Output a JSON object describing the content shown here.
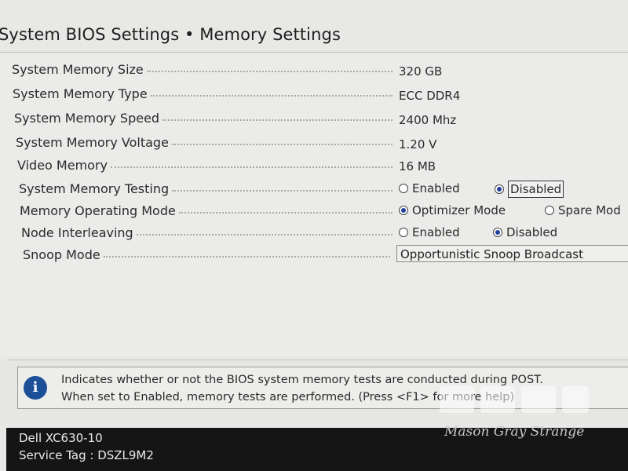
{
  "header": {
    "title": "System BIOS Settings • Memory Settings"
  },
  "settings": {
    "memory_size": {
      "label": "System Memory Size",
      "value": "320 GB"
    },
    "memory_type": {
      "label": "System Memory Type",
      "value": "ECC DDR4"
    },
    "memory_speed": {
      "label": "System Memory Speed",
      "value": "2400 Mhz"
    },
    "memory_voltage": {
      "label": "System Memory Voltage",
      "value": "1.20 V"
    },
    "video_memory": {
      "label": "Video Memory",
      "value": "16 MB"
    },
    "memory_testing": {
      "label": "System Memory Testing",
      "options": [
        "Enabled",
        "Disabled"
      ],
      "selected": "Disabled"
    },
    "operating_mode": {
      "label": "Memory Operating Mode",
      "options": [
        "Optimizer Mode",
        "Spare Mod"
      ],
      "selected": "Optimizer Mode"
    },
    "node_interleaving": {
      "label": "Node Interleaving",
      "options": [
        "Enabled",
        "Disabled"
      ],
      "selected": "Disabled"
    },
    "snoop_mode": {
      "label": "Snoop Mode",
      "value": "Opportunistic Snoop Broadcast"
    }
  },
  "help": {
    "icon": "info-icon",
    "line1": "Indicates whether or not the BIOS system memory tests are conducted during POST.",
    "line2": "When set to Enabled, memory tests are performed. (Press <F1> for more help)"
  },
  "footer": {
    "model": "Dell XC630-10",
    "service_tag": "Service Tag : DSZL9M2"
  },
  "watermark": {
    "name": "Mason Gray Strange"
  },
  "colors": {
    "radio_selected": "#1f3f9a",
    "footer_bg": "#151515",
    "info_icon": "#1b4f98"
  }
}
